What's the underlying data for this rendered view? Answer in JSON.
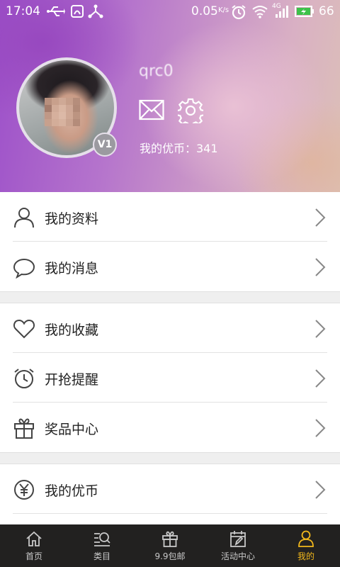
{
  "status_bar": {
    "time": "17:04",
    "speed": "0.05",
    "speed_unit": "K/s",
    "network": "4G",
    "battery": "66"
  },
  "profile": {
    "username": "qrc0",
    "coins_label": "我的优币：341",
    "level_badge": "V1"
  },
  "menu": {
    "groups": [
      [
        {
          "label": "我的资料",
          "icon": "user-icon"
        },
        {
          "label": "我的消息",
          "icon": "chat-bubble-icon"
        }
      ],
      [
        {
          "label": "我的收藏",
          "icon": "heart-icon"
        },
        {
          "label": "开抢提醒",
          "icon": "alarm-clock-icon"
        },
        {
          "label": "奖品中心",
          "icon": "gift-icon"
        }
      ],
      [
        {
          "label": "我的优币",
          "icon": "yen-coin-icon"
        }
      ]
    ]
  },
  "tabbar": {
    "items": [
      {
        "label": "首页",
        "icon": "home-icon"
      },
      {
        "label": "类目",
        "icon": "category-search-icon"
      },
      {
        "label": "9.9包邮",
        "icon": "gift-box-icon"
      },
      {
        "label": "活动中心",
        "icon": "calendar-edit-icon"
      },
      {
        "label": "我的",
        "icon": "person-icon"
      }
    ],
    "active_index": 4
  },
  "colors": {
    "accent": "#f2b81c",
    "tabbar_bg": "#222120",
    "header_purple": "#9c4fc9"
  }
}
